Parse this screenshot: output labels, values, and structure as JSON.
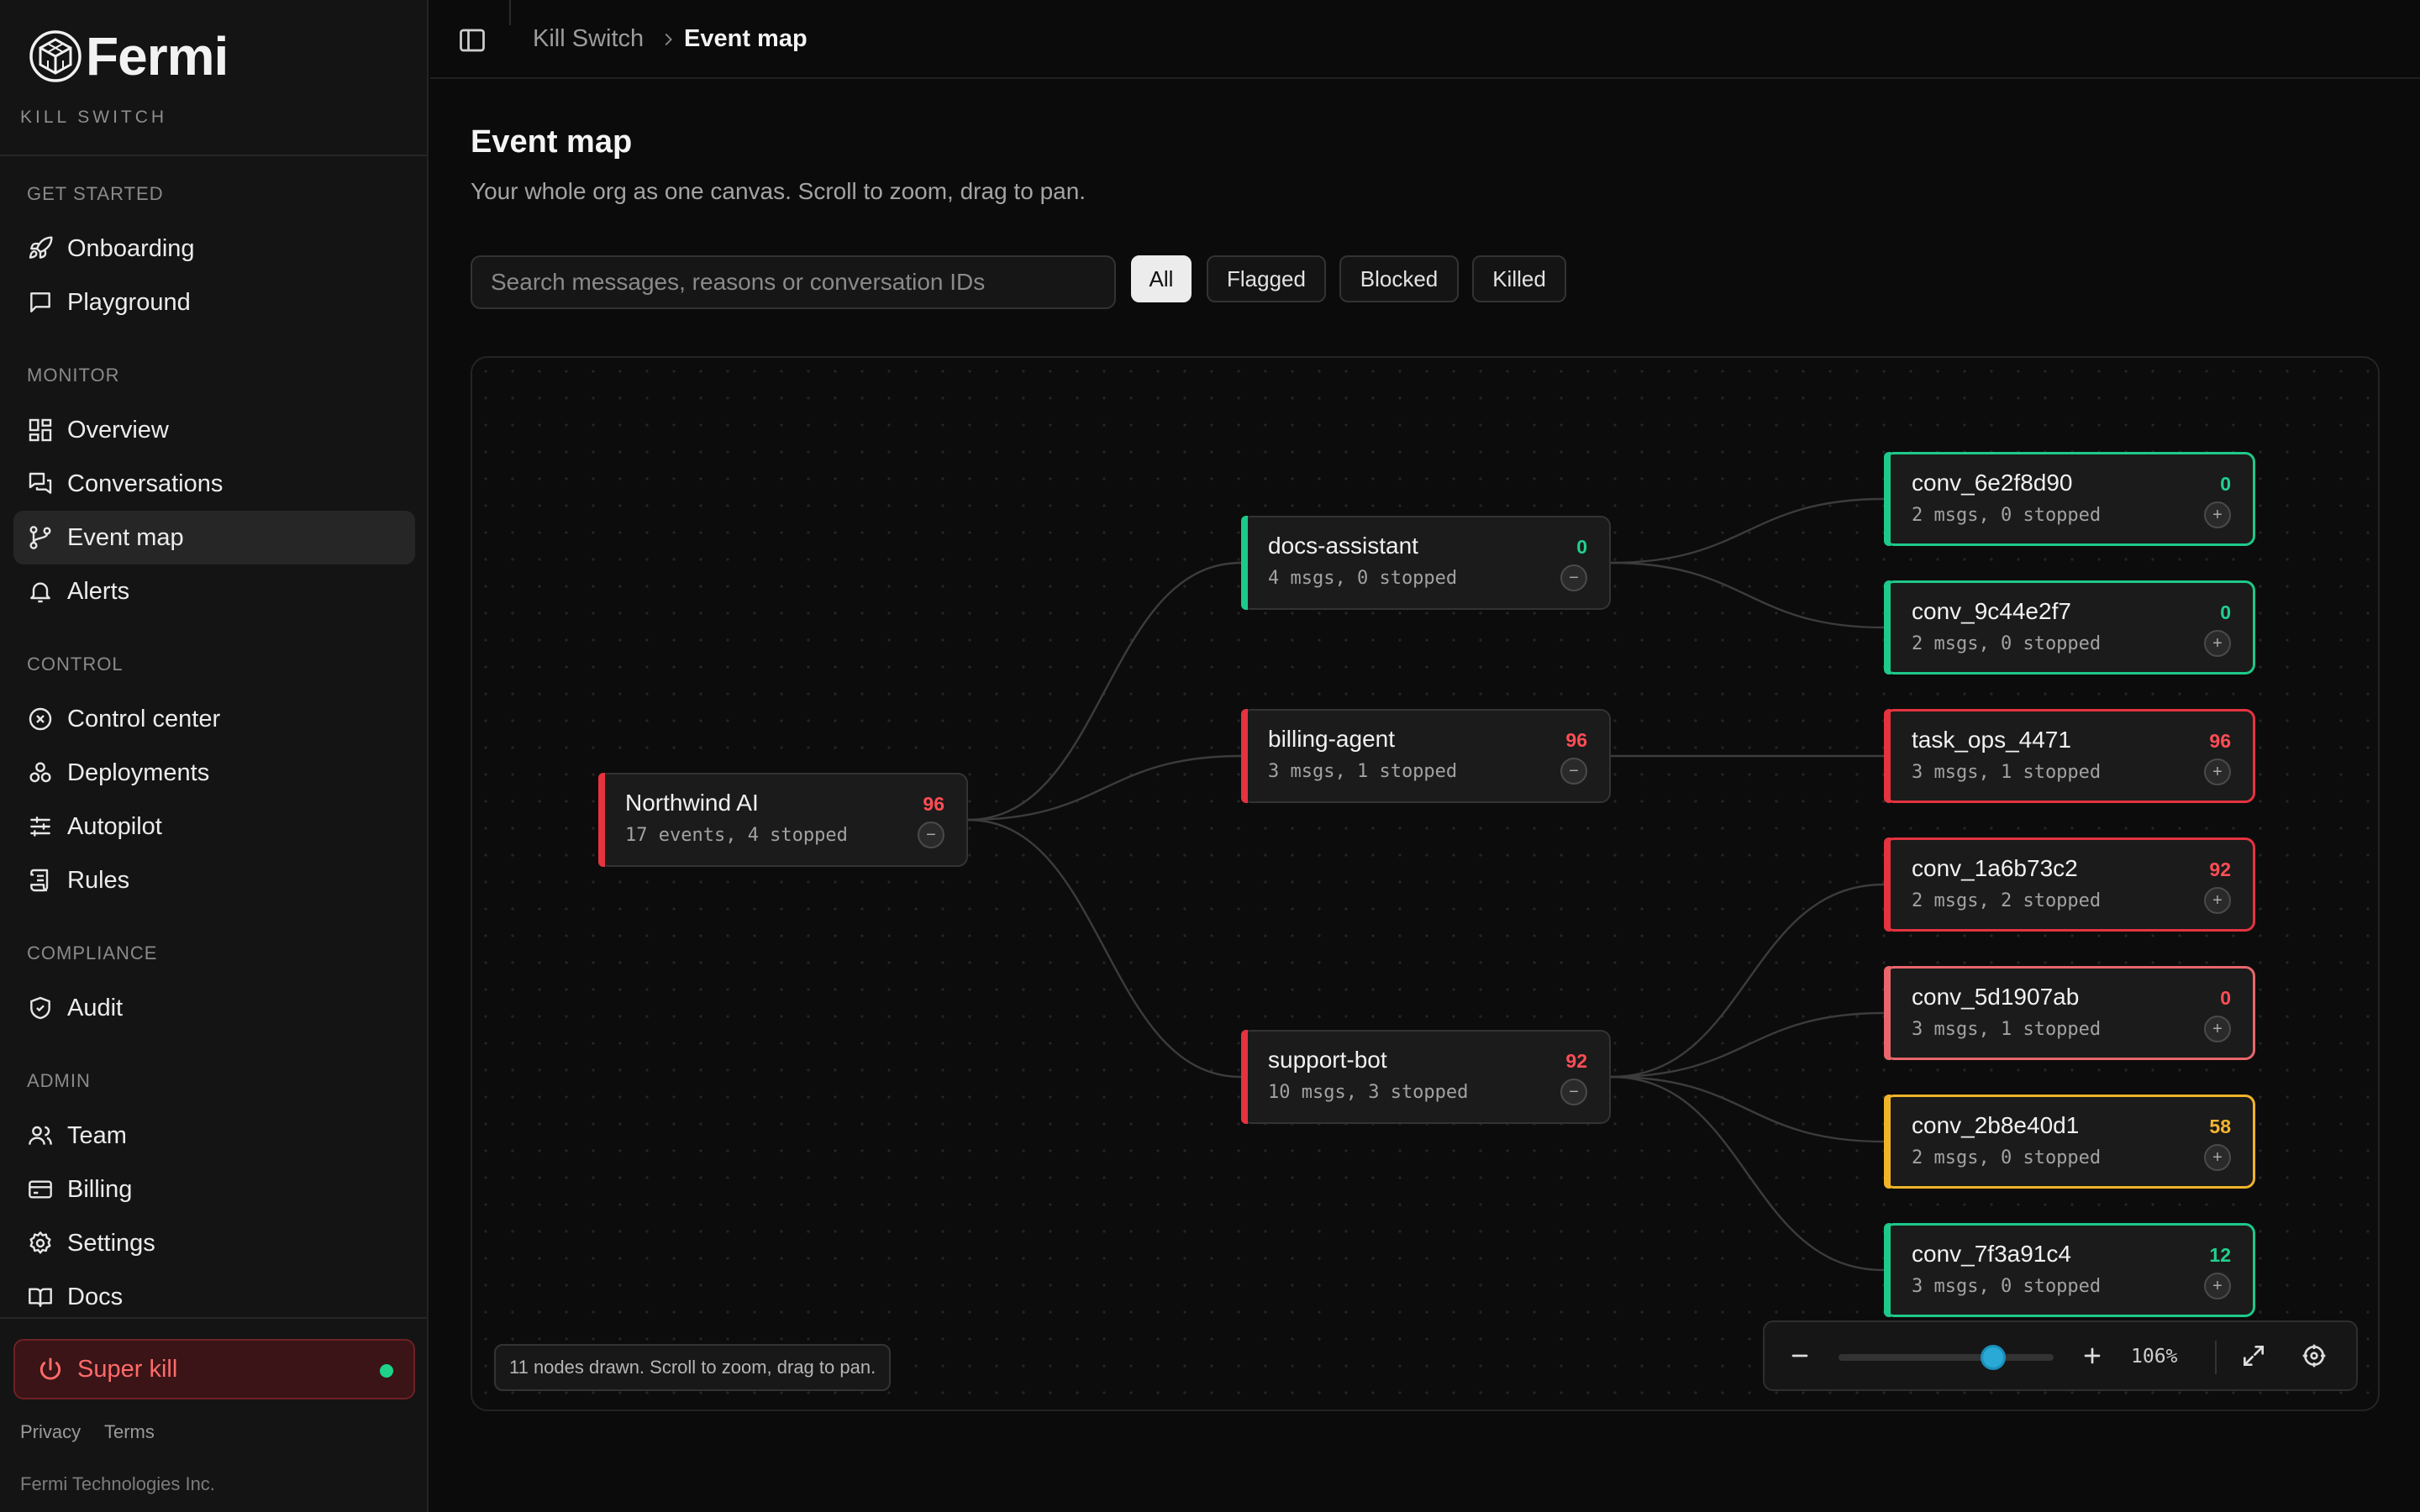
{
  "app": {
    "brand": "Fermi",
    "product": "KILL SWITCH"
  },
  "sidebar": {
    "sections": [
      {
        "label": "GET STARTED",
        "items": [
          {
            "label": "Onboarding",
            "icon": "rocket-icon"
          },
          {
            "label": "Playground",
            "icon": "chat-bubble-icon"
          }
        ]
      },
      {
        "label": "MONITOR",
        "items": [
          {
            "label": "Overview",
            "icon": "dashboard-icon"
          },
          {
            "label": "Conversations",
            "icon": "conversations-icon"
          },
          {
            "label": "Event map",
            "icon": "git-branch-icon",
            "active": true
          },
          {
            "label": "Alerts",
            "icon": "bell-icon"
          }
        ]
      },
      {
        "label": "CONTROL",
        "items": [
          {
            "label": "Control center",
            "icon": "circle-x-icon"
          },
          {
            "label": "Deployments",
            "icon": "boxes-icon"
          },
          {
            "label": "Autopilot",
            "icon": "sliders-icon"
          },
          {
            "label": "Rules",
            "icon": "scroll-icon"
          }
        ]
      },
      {
        "label": "COMPLIANCE",
        "items": [
          {
            "label": "Audit",
            "icon": "shield-check-icon"
          }
        ]
      },
      {
        "label": "ADMIN",
        "items": [
          {
            "label": "Team",
            "icon": "users-icon"
          },
          {
            "label": "Billing",
            "icon": "credit-card-icon"
          },
          {
            "label": "Settings",
            "icon": "gear-icon"
          },
          {
            "label": "Docs",
            "icon": "book-icon"
          }
        ]
      }
    ],
    "super_kill": {
      "label": "Super kill",
      "status_color": "#1ed389"
    },
    "footer": {
      "privacy": "Privacy",
      "terms": "Terms",
      "copyright": "Fermi Technologies Inc."
    }
  },
  "breadcrumb": {
    "root": "Kill Switch",
    "current": "Event map"
  },
  "page": {
    "title": "Event map",
    "subtitle": "Your whole org as one canvas. Scroll to zoom, drag to pan."
  },
  "search": {
    "placeholder": "Search messages, reasons or conversation IDs",
    "value": ""
  },
  "filters": [
    {
      "label": "All",
      "active": true
    },
    {
      "label": "Flagged",
      "active": false
    },
    {
      "label": "Blocked",
      "active": false
    },
    {
      "label": "Killed",
      "active": false
    }
  ],
  "graph": {
    "root": {
      "id": "org",
      "title": "Northwind AI",
      "meta": "17 events, 4 stopped",
      "score": "96",
      "status": "red",
      "toggle": "−"
    },
    "agents": [
      {
        "id": "docs",
        "title": "docs-assistant",
        "meta": "4 msgs, 0 stopped",
        "score": "0",
        "status": "green",
        "toggle": "−"
      },
      {
        "id": "billing",
        "title": "billing-agent",
        "meta": "3 msgs, 1 stopped",
        "score": "96",
        "status": "red",
        "toggle": "−"
      },
      {
        "id": "support",
        "title": "support-bot",
        "meta": "10 msgs, 3 stopped",
        "score": "92",
        "status": "red",
        "toggle": "−"
      }
    ],
    "conversations": [
      {
        "id": "conv_6e2f8d90",
        "parent": "docs",
        "title": "conv_6e2f8d90",
        "meta": "2 msgs, 0 stopped",
        "score": "0",
        "status": "green",
        "toggle": "+"
      },
      {
        "id": "conv_9c44e2f7",
        "parent": "docs",
        "title": "conv_9c44e2f7",
        "meta": "2 msgs, 0 stopped",
        "score": "0",
        "status": "green",
        "toggle": "+"
      },
      {
        "id": "task_ops_4471",
        "parent": "billing",
        "title": "task_ops_4471",
        "meta": "3 msgs, 1 stopped",
        "score": "96",
        "status": "red",
        "toggle": "+"
      },
      {
        "id": "conv_1a6b73c2",
        "parent": "support",
        "title": "conv_1a6b73c2",
        "meta": "2 msgs, 2 stopped",
        "score": "92",
        "status": "red",
        "toggle": "+"
      },
      {
        "id": "conv_5d1907ab",
        "parent": "support",
        "title": "conv_5d1907ab",
        "meta": "3 msgs, 1 stopped",
        "score": "0",
        "status": "salmon",
        "toggle": "+"
      },
      {
        "id": "conv_2b8e40d1",
        "parent": "support",
        "title": "conv_2b8e40d1",
        "meta": "2 msgs, 0 stopped",
        "score": "58",
        "status": "amber",
        "toggle": "+"
      },
      {
        "id": "conv_7f3a91c4",
        "parent": "support",
        "title": "conv_7f3a91c4",
        "meta": "3 msgs, 0 stopped",
        "score": "12",
        "status": "green",
        "toggle": "+"
      }
    ]
  },
  "status_colors": {
    "red": "#e5333f",
    "green": "#1ec98a",
    "amber": "#f0b429",
    "salmon": "#e8666c"
  },
  "score_colors": {
    "red": "#ff4d55",
    "green": "#22d08f",
    "amber": "#f5b531",
    "salmon": "#ff4d55"
  },
  "canvas_info": "11 nodes drawn. Scroll to zoom, drag to pan.",
  "zoom": {
    "value_label": "106%",
    "level": 0.72,
    "accent": "#2aa9d6"
  }
}
